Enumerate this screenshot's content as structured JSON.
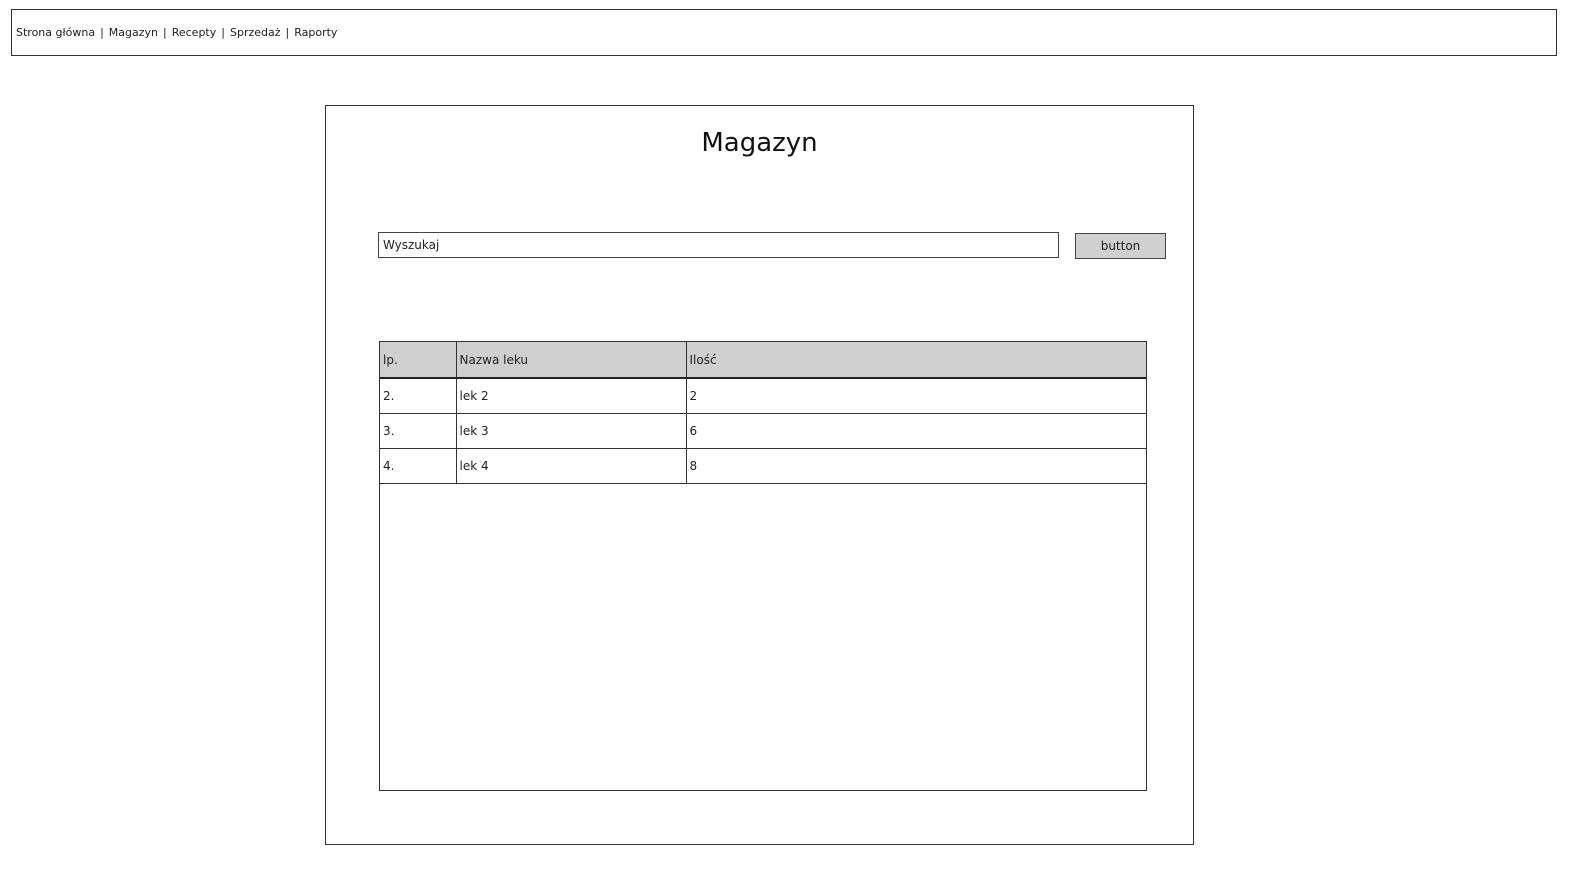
{
  "nav": {
    "items": [
      "Strona główna",
      "Magazyn",
      "Recepty",
      "Sprzedaż",
      "Raporty"
    ],
    "separator": "|"
  },
  "page": {
    "title": "Magazyn"
  },
  "search": {
    "value": "Wyszukaj",
    "button_label": "button"
  },
  "table": {
    "headers": [
      "lp.",
      "Nazwa leku",
      "Ilość"
    ],
    "rows": [
      [
        "2.",
        "lek 2",
        "2"
      ],
      [
        "3.",
        "lek 3",
        "6"
      ],
      [
        "4.",
        "lek 4",
        "8"
      ]
    ]
  }
}
